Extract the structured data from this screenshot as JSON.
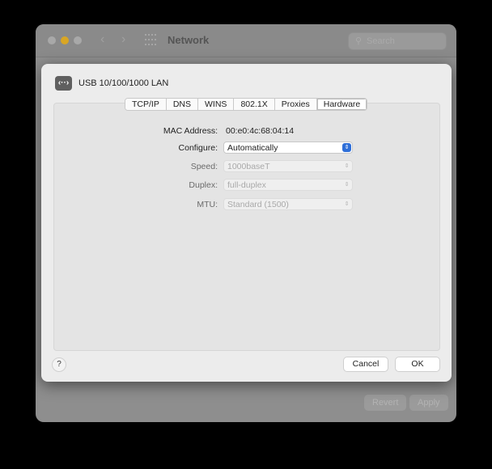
{
  "background_window": {
    "title": "Network",
    "search_placeholder": "Search",
    "revert_label": "Revert",
    "apply_label": "Apply",
    "icons": {
      "back": "chevron-left-icon",
      "forward": "chevron-right-icon",
      "grid": "grid-icon",
      "search": "magnifier-icon"
    }
  },
  "sheet": {
    "interface_icon": "network-interface-icon",
    "interface_icon_glyph": "‹··›",
    "interface_name": "USB 10/100/1000 LAN",
    "tabs": [
      {
        "label": "TCP/IP"
      },
      {
        "label": "DNS"
      },
      {
        "label": "WINS"
      },
      {
        "label": "802.1X"
      },
      {
        "label": "Proxies"
      },
      {
        "label": "Hardware",
        "active": true
      }
    ],
    "fields": {
      "mac_label": "MAC Address:",
      "mac_value": "00:e0:4c:68:04:14",
      "configure_label": "Configure:",
      "configure_value": "Automatically",
      "speed_label": "Speed:",
      "speed_value": "1000baseT",
      "duplex_label": "Duplex:",
      "duplex_value": "full-duplex",
      "mtu_label": "MTU:",
      "mtu_value": "Standard (1500)"
    },
    "help_label": "?",
    "cancel_label": "Cancel",
    "ok_label": "OK"
  },
  "colors": {
    "accent": "#2f6fd8",
    "traffic_light_min": "#d9a624"
  }
}
